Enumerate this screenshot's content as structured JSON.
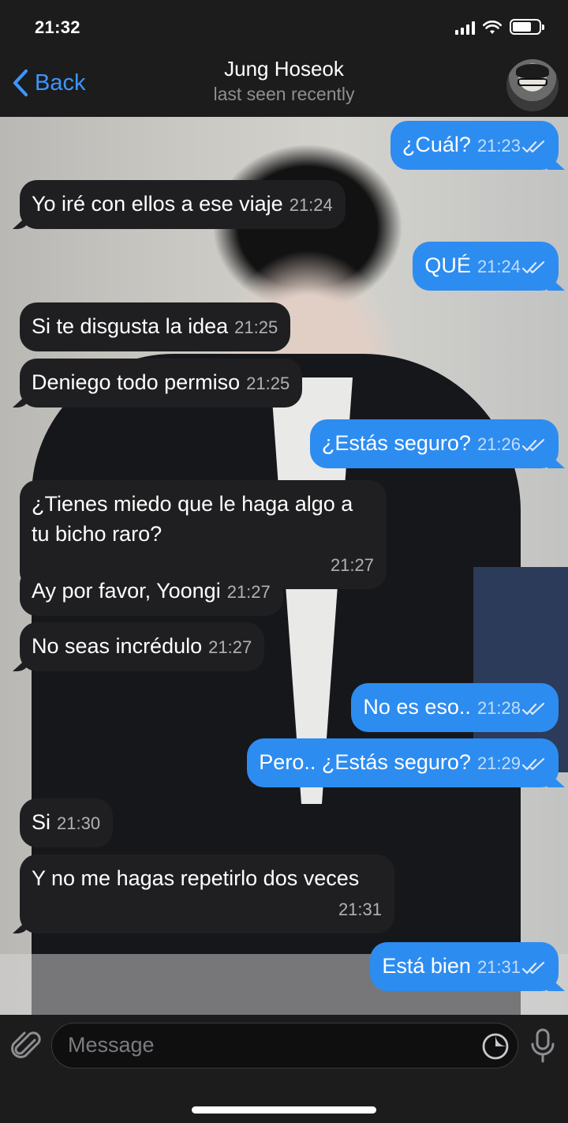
{
  "status_bar": {
    "time": "21:32"
  },
  "nav": {
    "back_label": "Back",
    "title": "Jung Hoseok",
    "subtitle": "last seen recently"
  },
  "messages": [
    {
      "dir": "out",
      "text": "¿Cuál?",
      "time": "21:23",
      "read": true
    },
    {
      "dir": "in",
      "text": "Yo iré con ellos a ese viaje",
      "time": "21:24"
    },
    {
      "dir": "out",
      "text": "QUÉ",
      "time": "21:24",
      "read": true
    },
    {
      "dir": "in",
      "text": "Si te disgusta la idea",
      "time": "21:25"
    },
    {
      "dir": "in",
      "text": "Deniego todo permiso",
      "time": "21:25"
    },
    {
      "dir": "out",
      "text": "¿Estás seguro?",
      "time": "21:26",
      "read": true
    },
    {
      "dir": "in",
      "text": "¿Tienes miedo que le haga algo a tu bicho raro?",
      "time": "21:27"
    },
    {
      "dir": "in",
      "text": "Ay por favor, Yoongi",
      "time": "21:27"
    },
    {
      "dir": "in",
      "text": "No seas incrédulo",
      "time": "21:27"
    },
    {
      "dir": "out",
      "text": "No es eso..",
      "time": "21:28",
      "read": true
    },
    {
      "dir": "out",
      "text": "Pero.. ¿Estás seguro?",
      "time": "21:29",
      "read": true
    },
    {
      "dir": "in",
      "text": "Si",
      "time": "21:30"
    },
    {
      "dir": "in",
      "text": "Y no me hagas repetirlo dos veces",
      "time": "21:31"
    },
    {
      "dir": "out",
      "text": "Está bien",
      "time": "21:31",
      "read": true
    }
  ],
  "composer": {
    "placeholder": "Message"
  },
  "icons": {
    "back": "chevron-left-icon",
    "attach": "paperclip-icon",
    "sticker": "sticker-icon",
    "mic": "microphone-icon",
    "read": "double-check-icon"
  },
  "colors": {
    "accent": "#3e95ff",
    "outgoing_bubble": "#2d8cf0",
    "incoming_bubble": "#1f1f21"
  }
}
